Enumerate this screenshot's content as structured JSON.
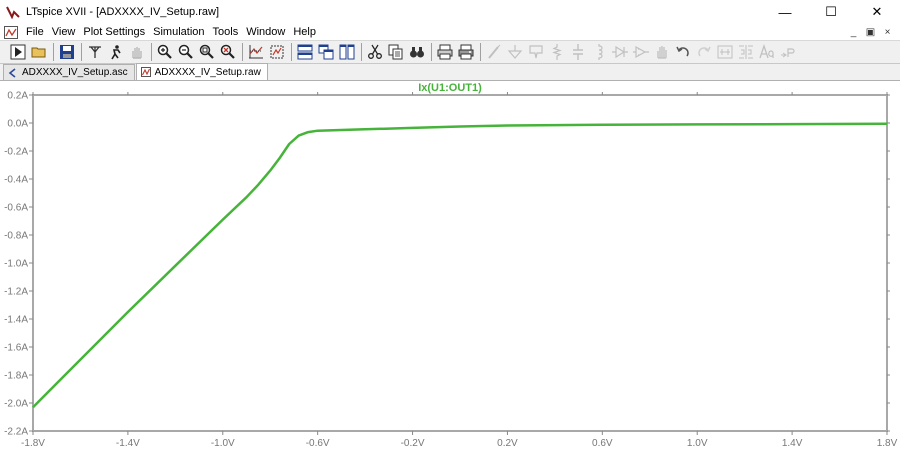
{
  "window": {
    "title": "LTspice XVII - [ADXXXX_IV_Setup.raw]",
    "minimize_glyph": "—",
    "maximize_glyph": "☐",
    "close_glyph": "✕"
  },
  "menu": {
    "items": [
      "File",
      "View",
      "Plot Settings",
      "Simulation",
      "Tools",
      "Window",
      "Help"
    ],
    "mdi_minimize": "_",
    "mdi_restore": "▣",
    "mdi_close": "×"
  },
  "toolbar": {
    "groups": [
      [
        "run-icon",
        "open-folder-icon"
      ],
      [
        "save-icon"
      ],
      [
        "probe-icon",
        "halt-icon",
        "pan-hand-icon"
      ],
      [
        "zoom-in-icon",
        "zoom-out-icon",
        "zoom-fit-icon",
        "zoom-cancel-icon"
      ],
      [
        "autorange-icon",
        "zoom-extent-icon"
      ],
      [
        "tile-horizontal-icon",
        "cascade-icon",
        "tile-vertical-icon"
      ],
      [
        "cut-icon",
        "copy-icon",
        "find-icon"
      ],
      [
        "print-icon",
        "print-setup-icon"
      ],
      [
        "draw-wire-icon",
        "ground-icon",
        "label-net-icon",
        "resistor-icon",
        "capacitor-icon",
        "inductor-icon",
        "diode-icon",
        "component-icon",
        "move-icon",
        "undo-icon",
        "redo-icon",
        "rotate-icon",
        "mirror-icon",
        "text-icon",
        "spice-directive-icon"
      ]
    ]
  },
  "tabs": [
    {
      "label": "ADXXXX_IV_Setup.asc",
      "icon": "schematic-icon",
      "active": false
    },
    {
      "label": "ADXXXX_IV_Setup.raw",
      "icon": "waveform-icon",
      "active": true
    }
  ],
  "chart_data": {
    "type": "line",
    "title": "Ix(U1:OUT1)",
    "xlabel": "",
    "ylabel": "",
    "xlim": [
      -1.8,
      1.8
    ],
    "ylim": [
      -2.2,
      0.2
    ],
    "x_ticks": [
      -1.8,
      -1.4,
      -1.0,
      -0.6,
      -0.2,
      0.2,
      0.6,
      1.0,
      1.4,
      1.8
    ],
    "x_tick_labels": [
      "-1.8V",
      "-1.4V",
      "-1.0V",
      "-0.6V",
      "-0.2V",
      "0.2V",
      "0.6V",
      "1.0V",
      "1.4V",
      "1.8V"
    ],
    "y_ticks": [
      0.2,
      0.0,
      -0.2,
      -0.4,
      -0.6,
      -0.8,
      -1.0,
      -1.2,
      -1.4,
      -1.6,
      -1.8,
      -2.0,
      -2.2
    ],
    "y_tick_labels": [
      "0.2A",
      "0.0A",
      "-0.2A",
      "-0.4A",
      "-0.6A",
      "-0.8A",
      "-1.0A",
      "-1.2A",
      "-1.4A",
      "-1.6A",
      "-1.8A",
      "-2.0A",
      "-2.2A"
    ],
    "grid": false,
    "series": [
      {
        "name": "Ix(U1:OUT1)",
        "color": "#46b33a",
        "x": [
          -1.8,
          -1.6,
          -1.4,
          -1.2,
          -1.0,
          -0.9,
          -0.85,
          -0.8,
          -0.76,
          -0.72,
          -0.68,
          -0.64,
          -0.6,
          -0.5,
          -0.4,
          -0.2,
          0.0,
          0.2,
          0.6,
          1.0,
          1.4,
          1.8
        ],
        "y": [
          -2.03,
          -1.69,
          -1.35,
          -1.02,
          -0.69,
          -0.53,
          -0.44,
          -0.34,
          -0.25,
          -0.15,
          -0.09,
          -0.065,
          -0.055,
          -0.05,
          -0.045,
          -0.035,
          -0.025,
          -0.018,
          -0.012,
          -0.01,
          -0.008,
          -0.005
        ]
      }
    ]
  }
}
